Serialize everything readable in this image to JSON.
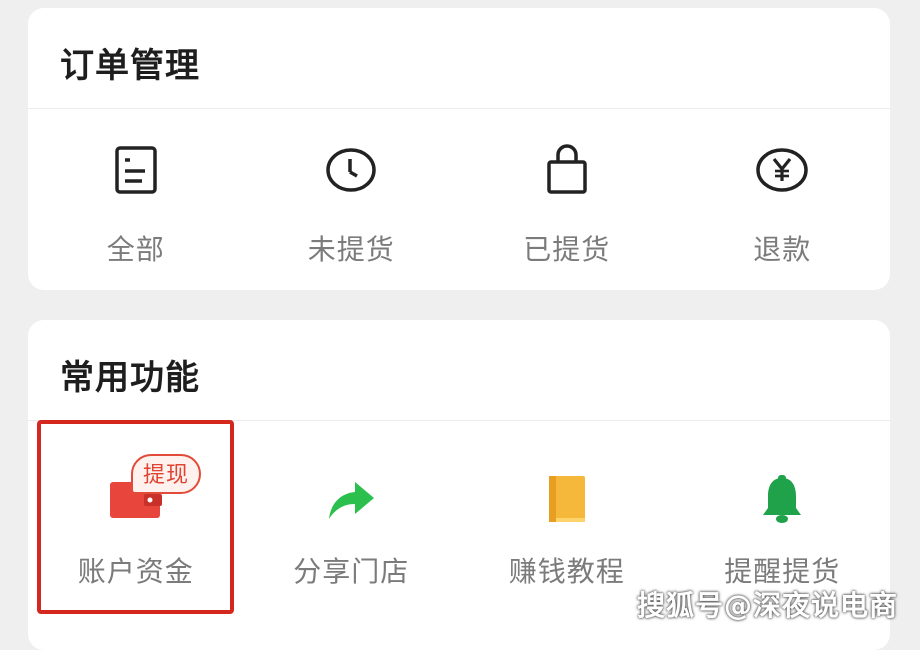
{
  "orders": {
    "title": "订单管理",
    "items": [
      {
        "label": "全部",
        "icon": "list-document-icon"
      },
      {
        "label": "未提货",
        "icon": "clock-icon"
      },
      {
        "label": "已提货",
        "icon": "shopping-bag-icon"
      },
      {
        "label": "退款",
        "icon": "yen-refund-icon"
      }
    ]
  },
  "tools": {
    "title": "常用功能",
    "items": [
      {
        "label": "账户资金",
        "icon": "wallet-icon",
        "badge": "提现"
      },
      {
        "label": "分享门店",
        "icon": "share-arrow-icon"
      },
      {
        "label": "赚钱教程",
        "icon": "book-icon"
      },
      {
        "label": "提醒提货",
        "icon": "bell-icon"
      }
    ]
  },
  "watermark": "搜狐号@深夜说电商",
  "colors": {
    "highlight": "#d4281f",
    "wallet": "#e8453c",
    "share": "#2bbf4e",
    "book": "#f5b83a",
    "bell": "#1fa24a"
  }
}
